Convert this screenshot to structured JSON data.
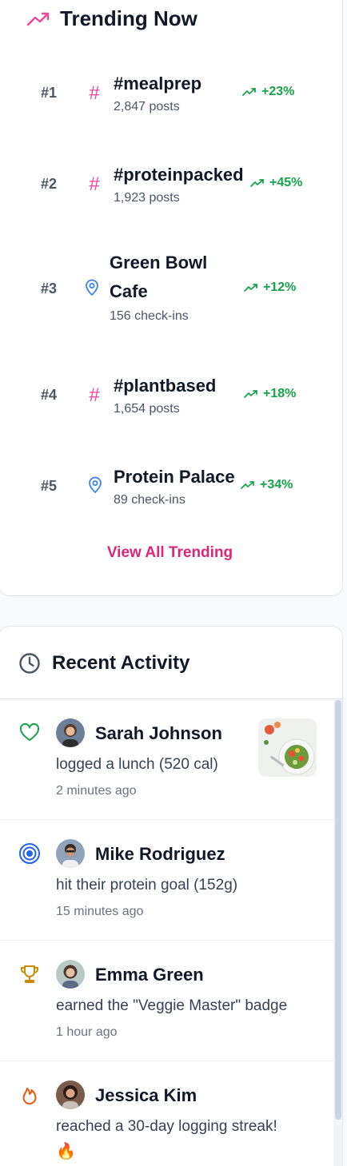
{
  "trending": {
    "title": "Trending Now",
    "header_icon": "trending-up-icon",
    "items": [
      {
        "rank": "#1",
        "type": "hashtag",
        "icon": "#",
        "name": "#mealprep",
        "sub": "2,847 posts",
        "change": "+23%"
      },
      {
        "rank": "#2",
        "type": "hashtag",
        "icon": "#",
        "name": "#proteinpacked",
        "sub": "1,923 posts",
        "change": "+45%"
      },
      {
        "rank": "#3",
        "type": "place",
        "icon": "map-pin-icon",
        "name_line1": "Green Bowl",
        "name_line2": "Cafe",
        "sub": "156 check-ins",
        "change": "+12%"
      },
      {
        "rank": "#4",
        "type": "hashtag",
        "icon": "#",
        "name": "#plantbased",
        "sub": "1,654 posts",
        "change": "+18%"
      },
      {
        "rank": "#5",
        "type": "place",
        "icon": "map-pin-icon",
        "name": "Protein Palace",
        "sub": "89 check-ins",
        "change": "+34%"
      }
    ],
    "view_all": "View All Trending"
  },
  "activity": {
    "title": "Recent Activity",
    "header_icon": "clock-icon",
    "items": [
      {
        "icon": "heart-icon",
        "user": "Sarah Johnson",
        "text": "logged a lunch (520 cal)",
        "time": "2 minutes ago",
        "has_thumbnail": true
      },
      {
        "icon": "target-icon",
        "user": "Mike Rodriguez",
        "text": "hit their protein goal (152g)",
        "time": "15 minutes ago"
      },
      {
        "icon": "trophy-icon",
        "user": "Emma Green",
        "text": "earned the \"Veggie Master\" badge",
        "time": "1 hour ago"
      },
      {
        "icon": "flame-icon",
        "user": "Jessica Kim",
        "text": "reached a 30-day logging streak!",
        "emoji": "🔥"
      }
    ]
  },
  "colors": {
    "accent_pink": "#db2777",
    "hashtag_pink": "#ec4899",
    "trend_green": "#16a34a",
    "pin_blue": "#3b82f6",
    "heart_green": "#16a34a",
    "target_blue": "#2563eb",
    "trophy_gold": "#ca8a04",
    "flame_orange": "#ea580c"
  }
}
